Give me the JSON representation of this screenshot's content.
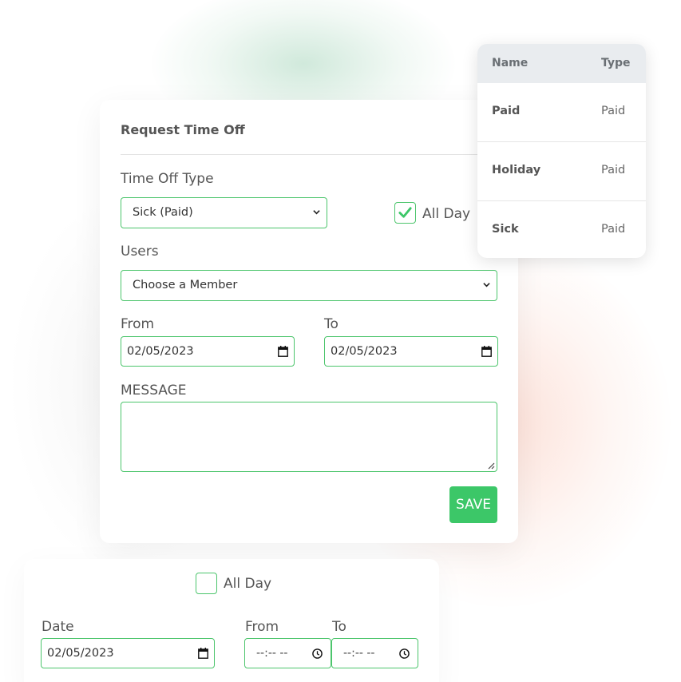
{
  "form": {
    "title": "Request Time Off",
    "time_off_type_label": "Time Off Type",
    "time_off_type_value": "Sick (Paid)",
    "all_day_label": "All Day",
    "all_day_checked": true,
    "users_label": "Users",
    "users_placeholder": "Choose a Member",
    "from_label": "From",
    "from_value": "02/05/2023",
    "to_label": "To",
    "to_value": "02/05/2023",
    "message_label": "MESSAGE",
    "message_value": "",
    "save_label": "SAVE"
  },
  "types_table": {
    "headers": {
      "name": "Name",
      "type": "Type"
    },
    "rows": [
      {
        "name": "Paid",
        "type": "Paid"
      },
      {
        "name": "Holiday",
        "type": "Paid"
      },
      {
        "name": "Sick",
        "type": "Paid"
      }
    ]
  },
  "bottom": {
    "all_day_label": "All Day",
    "all_day_checked": false,
    "date_label": "Date",
    "date_value": "02/05/2023",
    "from_label": "From",
    "from_value": "--:-- --",
    "to_label": "To",
    "to_value": "--:-- --"
  },
  "colors": {
    "accent": "#3cc768",
    "border_accent": "#4cc56c",
    "table_header_bg": "#e9ecef"
  },
  "icons": [
    "chevron-down-icon",
    "checkmark-icon",
    "calendar-icon",
    "clock-icon",
    "resize-handle-icon"
  ]
}
